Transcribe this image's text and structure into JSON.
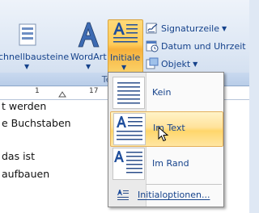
{
  "ribbon": {
    "group_label": "Text",
    "buttons": {
      "schnellbausteine": "chnellbausteine",
      "wordart": "WordArt",
      "initiale": "Initiale",
      "signaturzeile": "Signaturzeile",
      "datum": "Datum und Uhrzeit",
      "objekt": "Objekt"
    }
  },
  "ruler": {
    "marks": [
      "1",
      "17"
    ]
  },
  "document": {
    "lines": [
      "t werden",
      "e Buchstaben",
      "das ist",
      "aufbauen"
    ]
  },
  "menu": {
    "items": [
      {
        "label": "Kein"
      },
      {
        "label": "Im Text"
      },
      {
        "label": "Im Rand"
      }
    ],
    "options_label": "Initialoptionen...",
    "hovered_item": "Im Text"
  },
  "colors": {
    "accent": "#ffcc5a",
    "text": "#15428b"
  }
}
